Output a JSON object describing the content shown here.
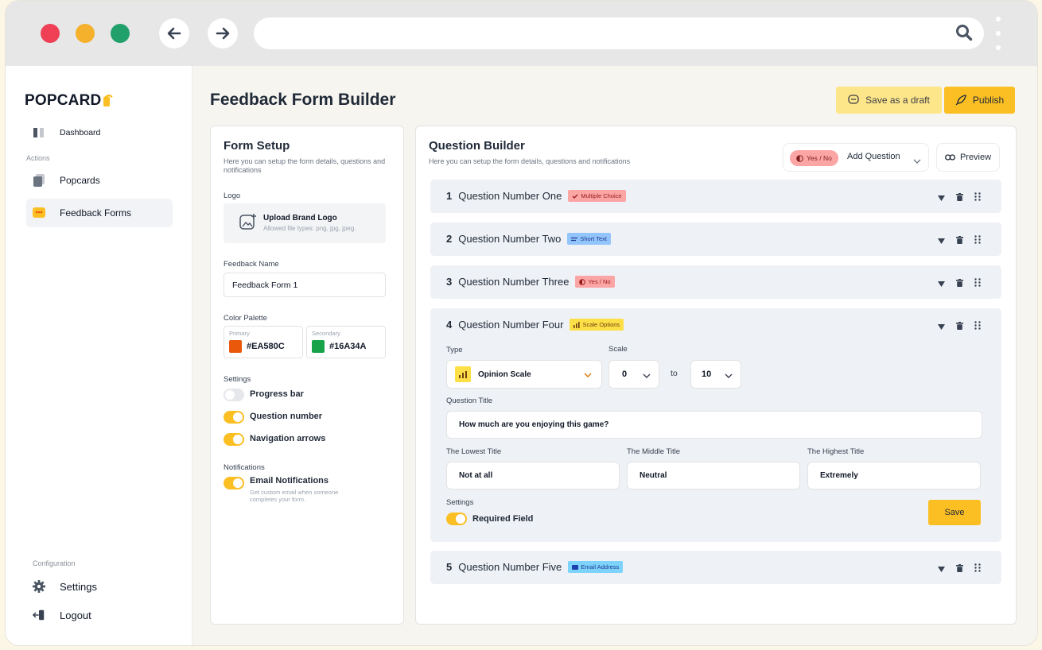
{
  "brand": {
    "name": "POPCARD"
  },
  "sidebar": {
    "items": [
      {
        "label": "Dashboard"
      },
      {
        "label": "Popcards"
      },
      {
        "label": "Feedback Forms"
      }
    ],
    "actions_caption": "Actions",
    "config_caption": "Configuration",
    "settings_label": "Settings",
    "logout_label": "Logout"
  },
  "header": {
    "title": "Feedback Form Builder",
    "draft_label": "Save as a draft",
    "publish_label": "Publish"
  },
  "setup": {
    "title": "Form Setup",
    "subtitle": "Here you can setup the form details, questions and notifications",
    "logo_label": "Logo",
    "upload_title": "Upload Brand Logo",
    "upload_hint": "Allowed file types: png, jpg, jpeg.",
    "name_label": "Feedback Name",
    "name_value": "Feedback Form 1",
    "palette_label": "Color Palette",
    "primary_caption": "Primary",
    "primary_hex": "#EA580C",
    "secondary_caption": "Secondary",
    "secondary_hex": "#16A34A",
    "settings_label": "Settings",
    "toggles": [
      {
        "label": "Progress bar",
        "on": false
      },
      {
        "label": "Question number",
        "on": true
      },
      {
        "label": "Navigation arrows",
        "on": true
      }
    ],
    "notifications_label": "Notifications",
    "email_label": "Email Notifications",
    "email_on": true,
    "email_hint": "Get custom email when someone completes your form."
  },
  "builder": {
    "title": "Question Builder",
    "subtitle": "Here you can setup the form details, questions and notifications",
    "type_pill": "Yes / No",
    "add_question_label": "Add Question",
    "preview_label": "Preview",
    "questions": [
      {
        "num": "1",
        "title": "Question Number One",
        "tag": "Multiple Choice"
      },
      {
        "num": "2",
        "title": "Question Number Two",
        "tag": "Short Text"
      },
      {
        "num": "3",
        "title": "Question Number Three",
        "tag": "Yes / No"
      },
      {
        "num": "4",
        "title": "Question Number Four",
        "tag": "Scale Options"
      },
      {
        "num": "5",
        "title": "Question Number Five",
        "tag": "Email Address"
      }
    ],
    "expanded": {
      "type_label": "Type",
      "type_value": "Opinion Scale",
      "scale_label": "Scale",
      "scale_from": "0",
      "scale_to_word": "to",
      "scale_to": "10",
      "question_title_label": "Question Title",
      "question_title_value": "How much are you enjoying this game?",
      "lowest_label": "The Lowest Title",
      "lowest_value": "Not at all",
      "middle_label": "The Middle Title",
      "middle_value": "Neutral",
      "highest_label": "The Highest Title",
      "highest_value": "Extremely",
      "settings_label": "Settings",
      "required_label": "Required Field",
      "required_on": true,
      "save_label": "Save"
    }
  },
  "colors": {
    "accent": "#FBBF24",
    "primary": "#EA580C",
    "secondary": "#16A34A"
  }
}
